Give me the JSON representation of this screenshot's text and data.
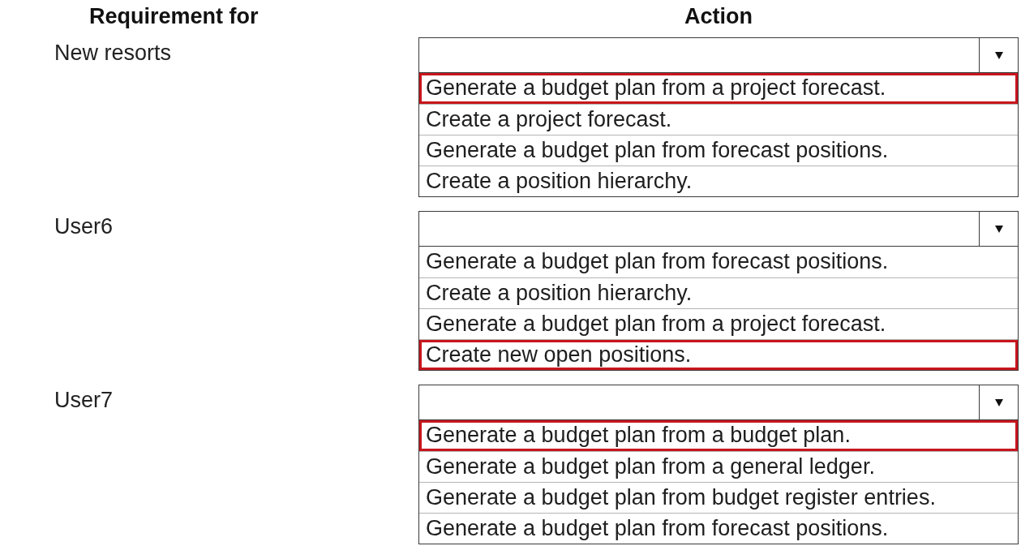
{
  "columns": [
    "Requirement for",
    "Action"
  ],
  "rows": [
    {
      "requirement": "New resorts",
      "options": [
        {
          "label": "Generate a budget plan from a project forecast.",
          "selected": true
        },
        {
          "label": "Create a project forecast.",
          "selected": false
        },
        {
          "label": "Generate a budget plan from forecast positions.",
          "selected": false
        },
        {
          "label": "Create a position hierarchy.",
          "selected": false
        }
      ]
    },
    {
      "requirement": "User6",
      "options": [
        {
          "label": "Generate a budget plan from forecast positions.",
          "selected": false
        },
        {
          "label": "Create a position hierarchy.",
          "selected": false
        },
        {
          "label": "Generate a budget plan from a project forecast.",
          "selected": false
        },
        {
          "label": "Create new open positions.",
          "selected": true
        }
      ]
    },
    {
      "requirement": "User7",
      "options": [
        {
          "label": "Generate a budget plan from a budget plan.",
          "selected": true
        },
        {
          "label": "Generate a budget plan from a general ledger.",
          "selected": false
        },
        {
          "label": "Generate a budget plan from budget register entries.",
          "selected": false
        },
        {
          "label": "Generate a budget plan from forecast positions.",
          "selected": false
        }
      ]
    }
  ]
}
